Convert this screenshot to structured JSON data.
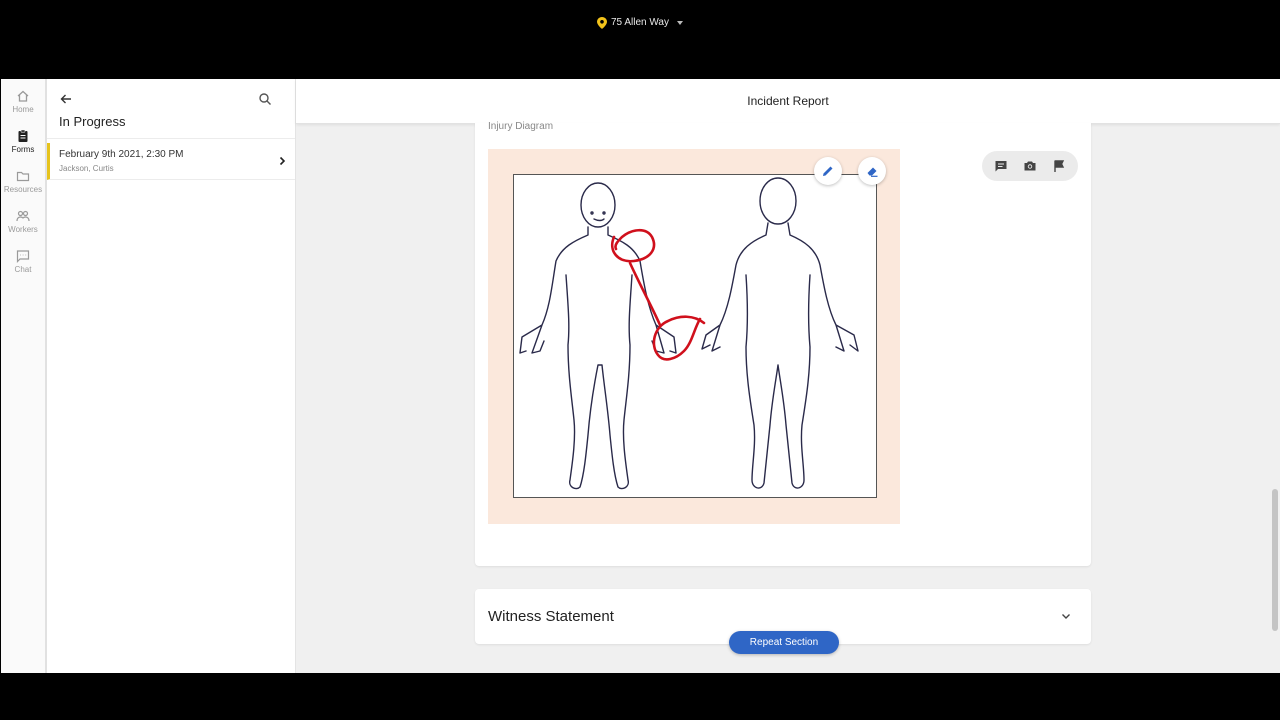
{
  "location": {
    "label": "75 Allen Way",
    "icon": "map-pin-icon"
  },
  "nav": [
    {
      "label": "Home",
      "icon": "home-icon"
    },
    {
      "label": "Forms",
      "icon": "clipboard-icon",
      "active": true
    },
    {
      "label": "Resources",
      "icon": "folder-icon"
    },
    {
      "label": "Workers",
      "icon": "people-icon"
    },
    {
      "label": "Chat",
      "icon": "chat-icon"
    }
  ],
  "list_panel": {
    "title": "In Progress",
    "items": [
      {
        "date": "February 9th 2021, 2:30 PM",
        "name": "Jackson, Curtis"
      }
    ]
  },
  "header": {
    "title": "Incident Report"
  },
  "injury_section": {
    "label": "Injury Diagram",
    "tools": [
      "pencil-icon",
      "eraser-icon"
    ],
    "actions": [
      "comment-icon",
      "camera-icon",
      "flag-icon"
    ]
  },
  "witness_section": {
    "title": "Witness Statement"
  },
  "repeat_button": {
    "label": "Repeat Section"
  },
  "colors": {
    "accent_blue": "#2f66c6",
    "active_marker": "#e6c31d",
    "annotation_red": "#d0101c"
  }
}
